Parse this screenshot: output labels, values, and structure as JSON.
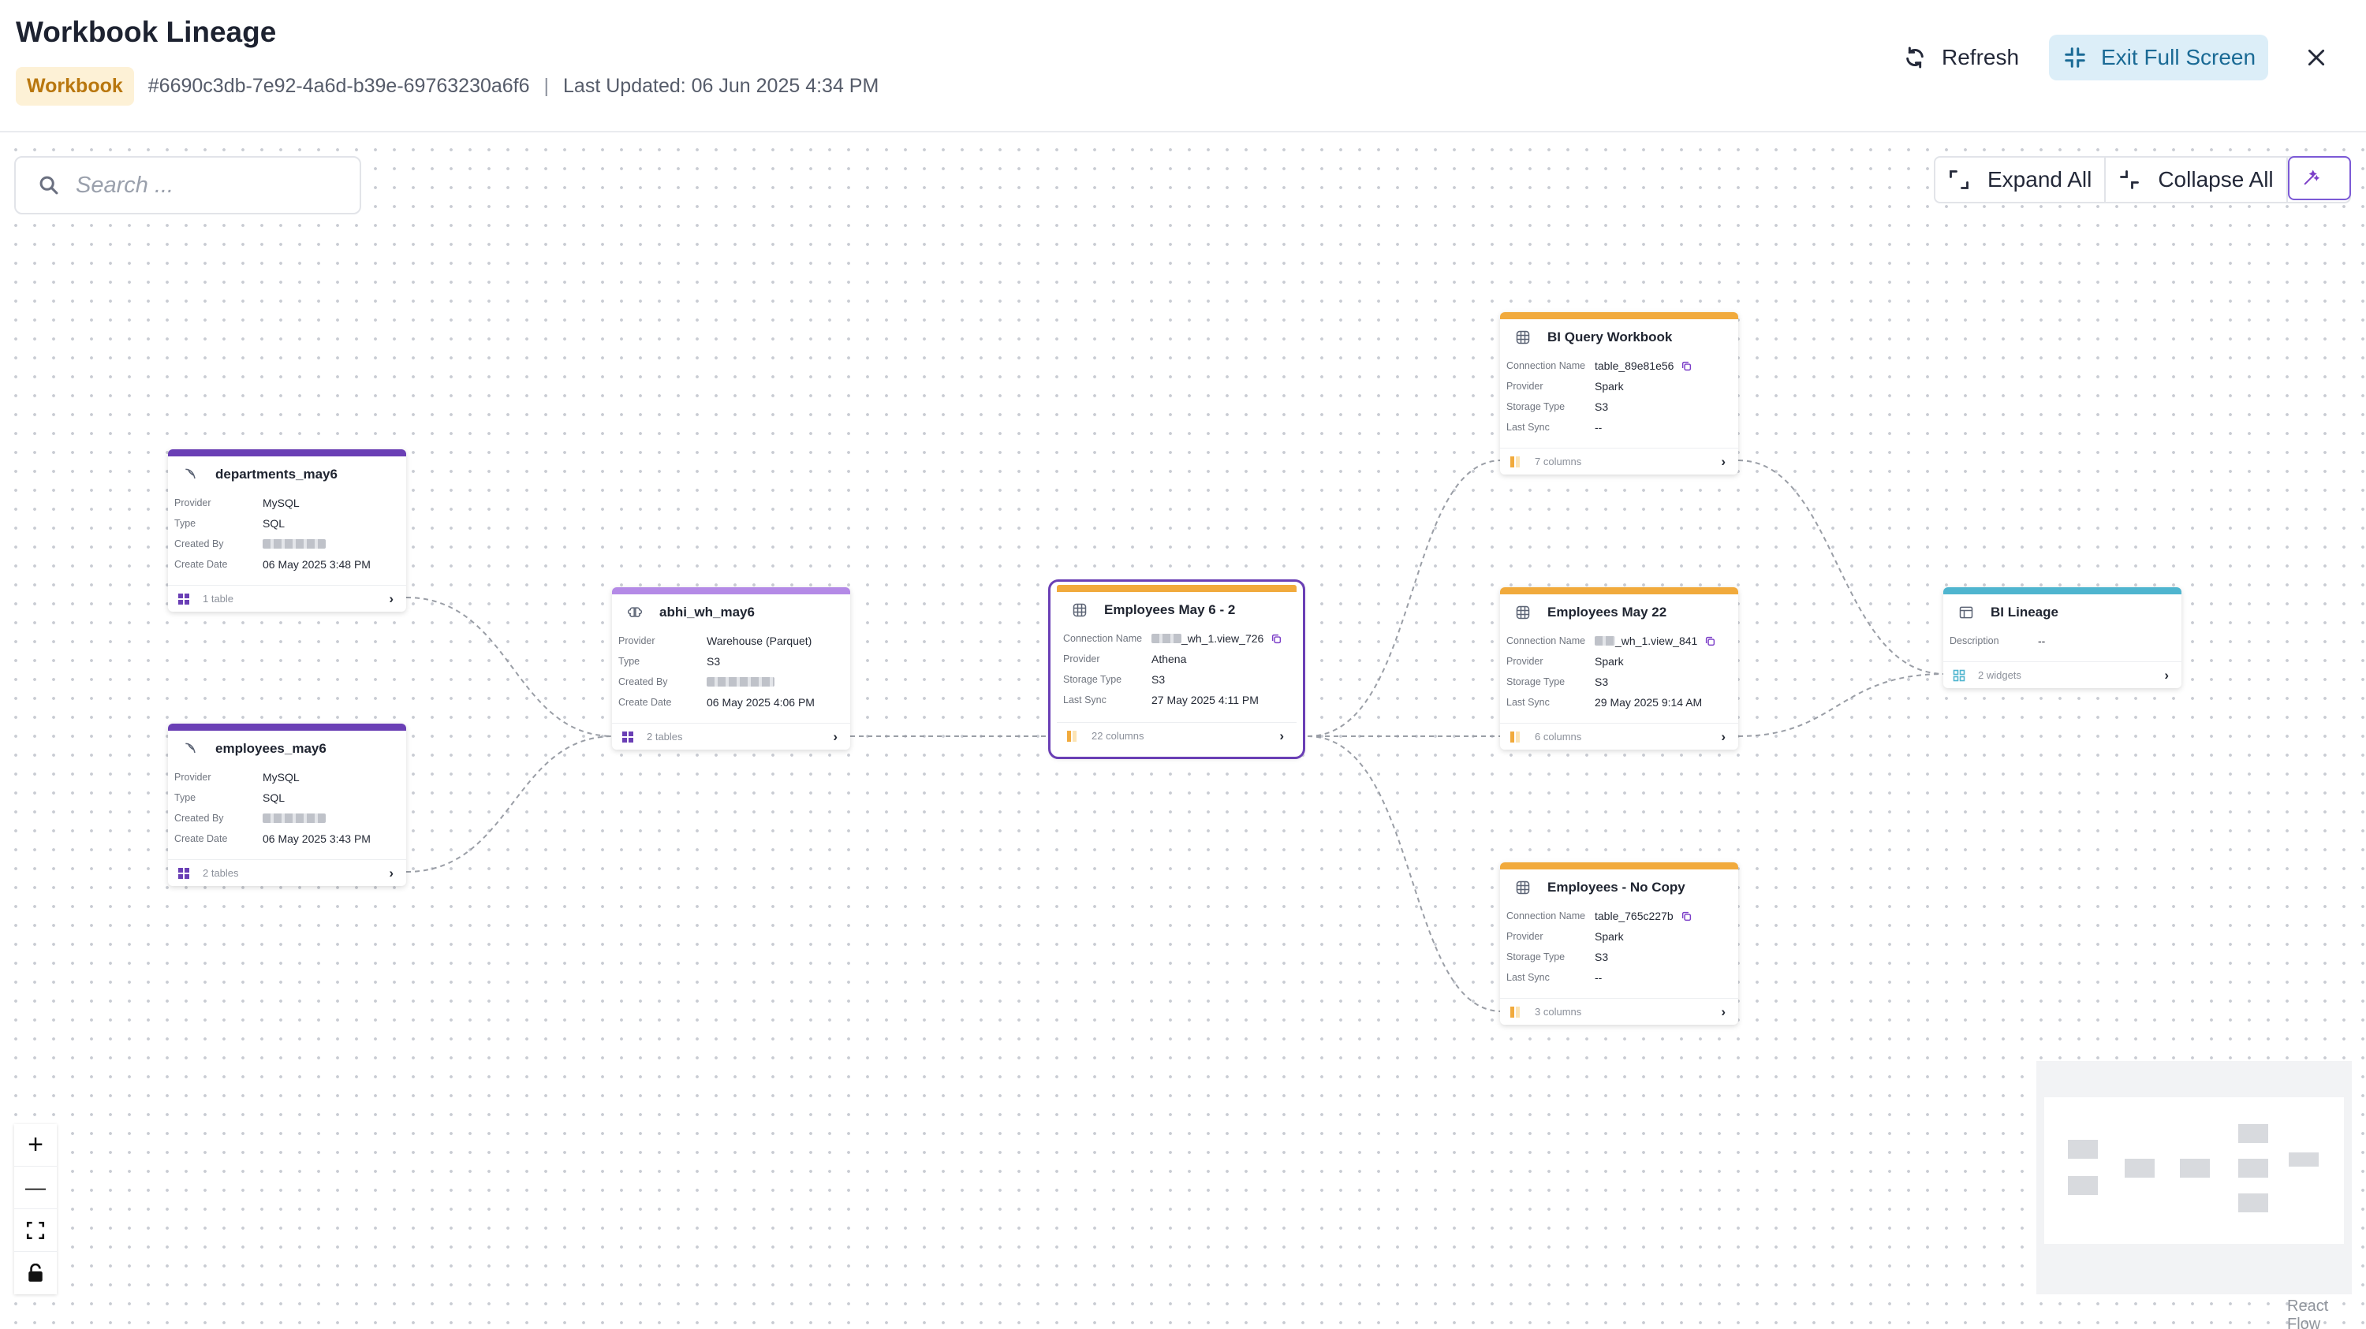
{
  "header": {
    "title": "Workbook Lineage",
    "badge": "Workbook",
    "id_text": "#6690c3db-7e92-4a6d-b39e-69763230a6f6",
    "separator": "|",
    "last_updated": "Last Updated: 06 Jun 2025 4:34 PM",
    "refresh_label": "Refresh",
    "exit_fullscreen_label": "Exit Full Screen"
  },
  "toolbar": {
    "search_placeholder": "Search ...",
    "expand_all": "Expand All",
    "collapse_all": "Collapse All"
  },
  "colors": {
    "mysql_bar": "#6a3fb5",
    "warehouse_bar": "#b48ae6",
    "dataset_bar": "#f1aa3c",
    "bi_bar": "#4fb5cf",
    "selected_outline": "#6a3fb5"
  },
  "nodes": {
    "departments": {
      "title": "departments_may6",
      "icon": "mysql-dolphin-icon",
      "provider_k": "Provider",
      "provider_v": "MySQL",
      "type_k": "Type",
      "type_v": "SQL",
      "created_by_k": "Created By",
      "create_date_k": "Create Date",
      "create_date_v": "06 May 2025 3:48 PM",
      "footer": "1 table"
    },
    "employees": {
      "title": "employees_may6",
      "icon": "mysql-dolphin-icon",
      "provider_k": "Provider",
      "provider_v": "MySQL",
      "type_k": "Type",
      "type_v": "SQL",
      "created_by_k": "Created By",
      "create_date_k": "Create Date",
      "create_date_v": "06 May 2025 3:43 PM",
      "footer": "2 tables"
    },
    "abhi": {
      "title": "abhi_wh_may6",
      "icon": "warehouse-brain-icon",
      "provider_k": "Provider",
      "provider_v": "Warehouse (Parquet)",
      "type_k": "Type",
      "type_v": "S3",
      "created_by_k": "Created By",
      "create_date_k": "Create Date",
      "create_date_v": "06 May 2025 4:06 PM",
      "footer": "2 tables"
    },
    "emp_may6_2": {
      "title": "Employees May 6 - 2",
      "icon": "dataset-grid-icon",
      "conn_k": "Connection Name",
      "conn_v": "_wh_1.view_726",
      "provider_k": "Provider",
      "provider_v": "Athena",
      "storage_k": "Storage Type",
      "storage_v": "S3",
      "sync_k": "Last Sync",
      "sync_v": "27 May 2025 4:11 PM",
      "footer": "22 columns"
    },
    "bi_query": {
      "title": "BI Query Workbook",
      "icon": "dataset-grid-icon",
      "conn_k": "Connection Name",
      "conn_v": "table_89e81e56",
      "provider_k": "Provider",
      "provider_v": "Spark",
      "storage_k": "Storage Type",
      "storage_v": "S3",
      "sync_k": "Last Sync",
      "sync_v": "--",
      "footer": "7 columns"
    },
    "emp_may22": {
      "title": "Employees May 22",
      "icon": "dataset-grid-icon",
      "conn_k": "Connection Name",
      "conn_v": "_wh_1.view_841",
      "provider_k": "Provider",
      "provider_v": "Spark",
      "storage_k": "Storage Type",
      "storage_v": "S3",
      "sync_k": "Last Sync",
      "sync_v": "29 May 2025 9:14 AM",
      "footer": "6 columns"
    },
    "emp_nocopy": {
      "title": "Employees - No Copy",
      "icon": "dataset-grid-icon",
      "conn_k": "Connection Name",
      "conn_v": "table_765c227b",
      "provider_k": "Provider",
      "provider_v": "Spark",
      "storage_k": "Storage Type",
      "storage_v": "S3",
      "sync_k": "Last Sync",
      "sync_v": "--",
      "footer": "3 columns"
    },
    "bi_lineage": {
      "title": "BI Lineage",
      "icon": "workbook-layout-icon",
      "desc_k": "Description",
      "desc_v": "--",
      "footer": "2 widgets"
    }
  },
  "controls": {
    "zoom_in": "+",
    "zoom_out": "—"
  },
  "attribution": "React Flow"
}
